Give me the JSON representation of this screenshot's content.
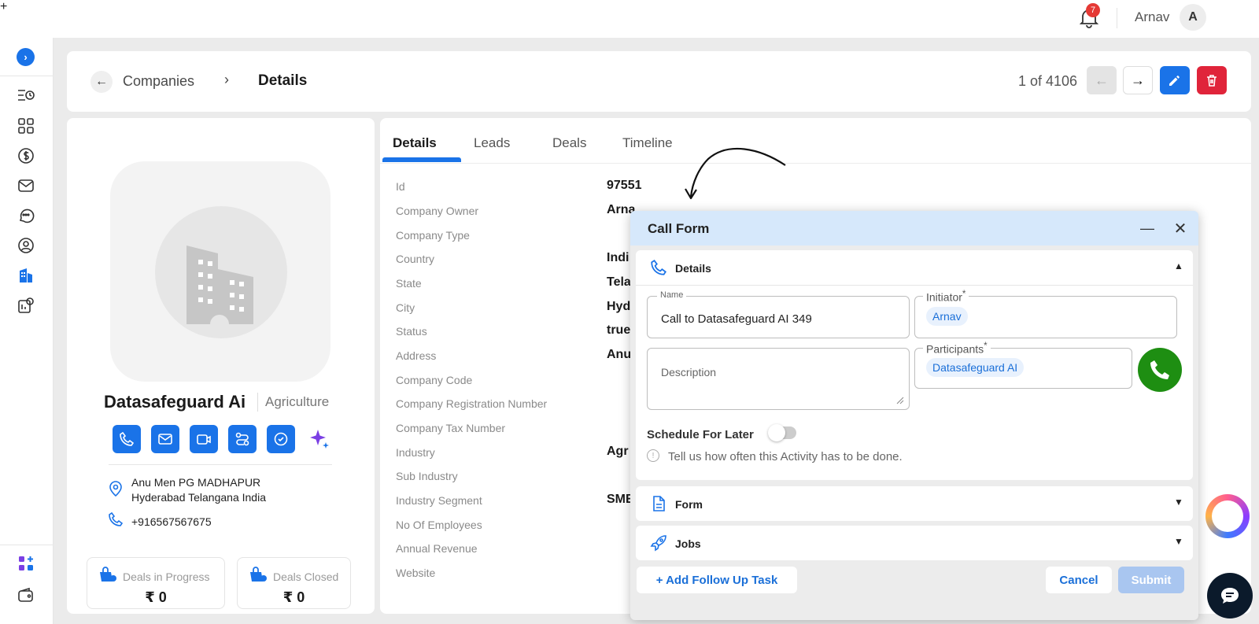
{
  "topbar": {
    "plus_label": "+",
    "notification_count": "7",
    "user_name": "Arnav",
    "avatar_initial": "A"
  },
  "sidebar": {
    "expand_label": "›",
    "icons": [
      "activity-list-icon",
      "apps-grid-icon",
      "dollar-icon",
      "mail-icon",
      "chat-icon",
      "user-circle-icon",
      "company-building-icon",
      "settings-cog-icon",
      "apps-add-icon",
      "wallet-icon"
    ]
  },
  "breadcrumb": {
    "back": "←",
    "parent": "Companies",
    "separator": "›",
    "current": "Details"
  },
  "pager": {
    "text": "1 of 4106",
    "prev": "←",
    "next": "→"
  },
  "company": {
    "name": "Datasafeguard Ai",
    "industry": "Agriculture",
    "address_line1": "Anu Men PG MADHAPUR",
    "address_line2": "Hyderabad Telangana India",
    "phone": "+916567567675",
    "stats": [
      {
        "label": "Deals in Progress",
        "value": "₹ 0"
      },
      {
        "label": "Deals Closed",
        "value": "₹ 0"
      }
    ]
  },
  "tabs": [
    "Details",
    "Leads",
    "Deals",
    "Timeline"
  ],
  "fields": [
    {
      "label": "Id",
      "value": "97551"
    },
    {
      "label": "Company Owner",
      "value": "Arna"
    },
    {
      "label": "Company Type",
      "value": ""
    },
    {
      "label": "Country",
      "value": "Indi"
    },
    {
      "label": "State",
      "value": "Tela"
    },
    {
      "label": "City",
      "value": "Hyd"
    },
    {
      "label": "Status",
      "value": "true"
    },
    {
      "label": "Address",
      "value": "Anu"
    },
    {
      "label": "Company Code",
      "value": ""
    },
    {
      "label": "Company Registration Number",
      "value": ""
    },
    {
      "label": "Company Tax Number",
      "value": ""
    },
    {
      "label": "Industry",
      "value": "Agr"
    },
    {
      "label": "Sub Industry",
      "value": ""
    },
    {
      "label": "Industry Segment",
      "value": "SME"
    },
    {
      "label": "No Of Employees",
      "value": ""
    },
    {
      "label": "Annual Revenue",
      "value": ""
    },
    {
      "label": "Website",
      "value": ""
    }
  ],
  "call_form": {
    "title": "Call Form",
    "minimize": "—",
    "close": "✕",
    "details_section": "Details",
    "name_label": "Name",
    "name_value": "Call to Datasafeguard AI 349",
    "initiator_label": "Initiator",
    "initiator_chip": "Arnav",
    "description_placeholder": "Description",
    "participants_label": "Participants",
    "participants_chip": "Datasafeguard AI",
    "schedule_label": "Schedule For Later",
    "info_text": "Tell us how often this Activity has to be done.",
    "form_section": "Form",
    "jobs_section": "Jobs",
    "followup_button": "+ Add Follow Up Task",
    "cancel_button": "Cancel",
    "submit_button": "Submit",
    "required_mark": "*"
  },
  "colors": {
    "primary": "#1a73e8",
    "danger": "#e0243a",
    "call_green": "#1e8e12",
    "modal_header": "#d6e8fb"
  }
}
